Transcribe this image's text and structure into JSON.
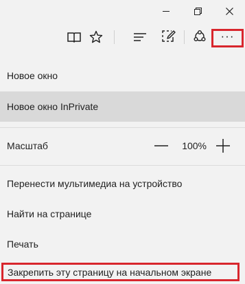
{
  "titlebar": {
    "minimize_icon": "minimize-icon",
    "restore_icon": "restore-icon",
    "close_icon": "close-icon"
  },
  "toolbar": {
    "reading_view_icon": "book-icon",
    "favorites_icon": "star-icon",
    "hub_icon": "hub-icon",
    "web_note_icon": "pen-note-icon",
    "share_icon": "share-icon",
    "more_label": "···"
  },
  "menu": {
    "new_window": "Новое окно",
    "new_inprivate": "Новое окно InPrivate",
    "zoom_label": "Масштаб",
    "zoom_value": "100%",
    "cast_media": "Перенести мультимедиа на устройство",
    "find_on_page": "Найти на странице",
    "print": "Печать",
    "pin_to_start": "Закрепить эту страницу на начальном экране"
  },
  "colors": {
    "background": "#f2f2f2",
    "hover": "#d9d9d9",
    "annotation_red": "#d8262d"
  }
}
